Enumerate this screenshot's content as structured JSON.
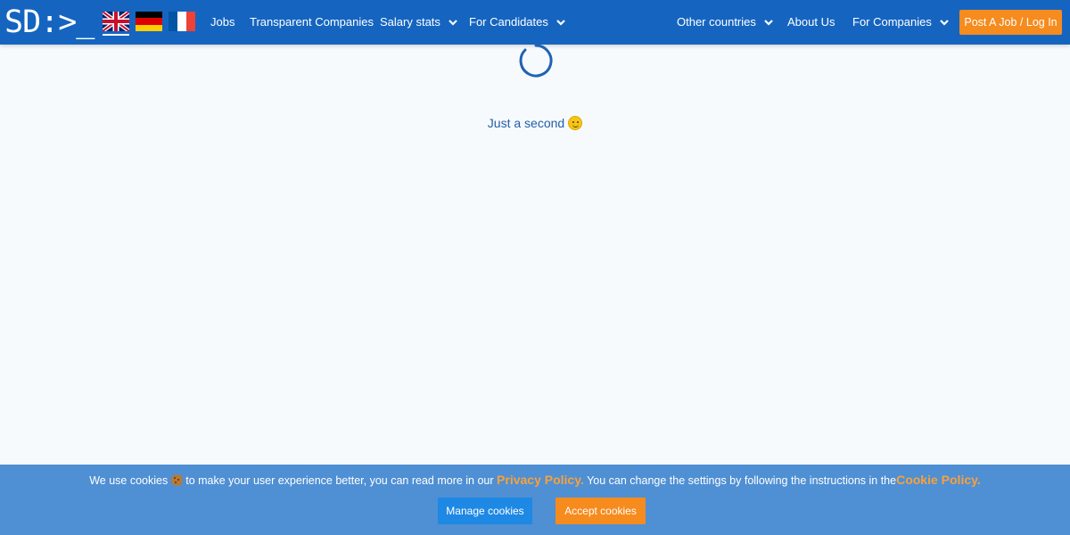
{
  "header": {
    "logo_text": "SD:>_",
    "flags": [
      "uk-flag-icon",
      "germany-flag-icon",
      "france-flag-icon"
    ],
    "nav": {
      "jobs": "Jobs",
      "transparent_companies": "Transparent Companies",
      "salary_stats": "Salary stats",
      "for_candidates": "For Candidates",
      "other_countries": "Other countries",
      "about_us": "About Us",
      "for_companies": "For Companies"
    },
    "post_job_label": "Post A Job / Log In",
    "colors": {
      "navbar": "#1565c0",
      "accent": "#f68b1e"
    }
  },
  "main": {
    "loading_text": "Just a second",
    "loading_icon": "smiley-icon"
  },
  "cookie_banner": {
    "text_before": "We use cookies",
    "text_middle": "to make your user experience better, you can read more in our",
    "privacy_link": "Privacy Policy.",
    "text_after": "You can change the settings by following the instructions in the",
    "cookie_policy_link": "Cookie Policy.",
    "manage_label": "Manage cookies",
    "accept_label": "Accept cookies",
    "colors": {
      "background": "#4f8fd4",
      "link": "#f7a23a"
    }
  }
}
